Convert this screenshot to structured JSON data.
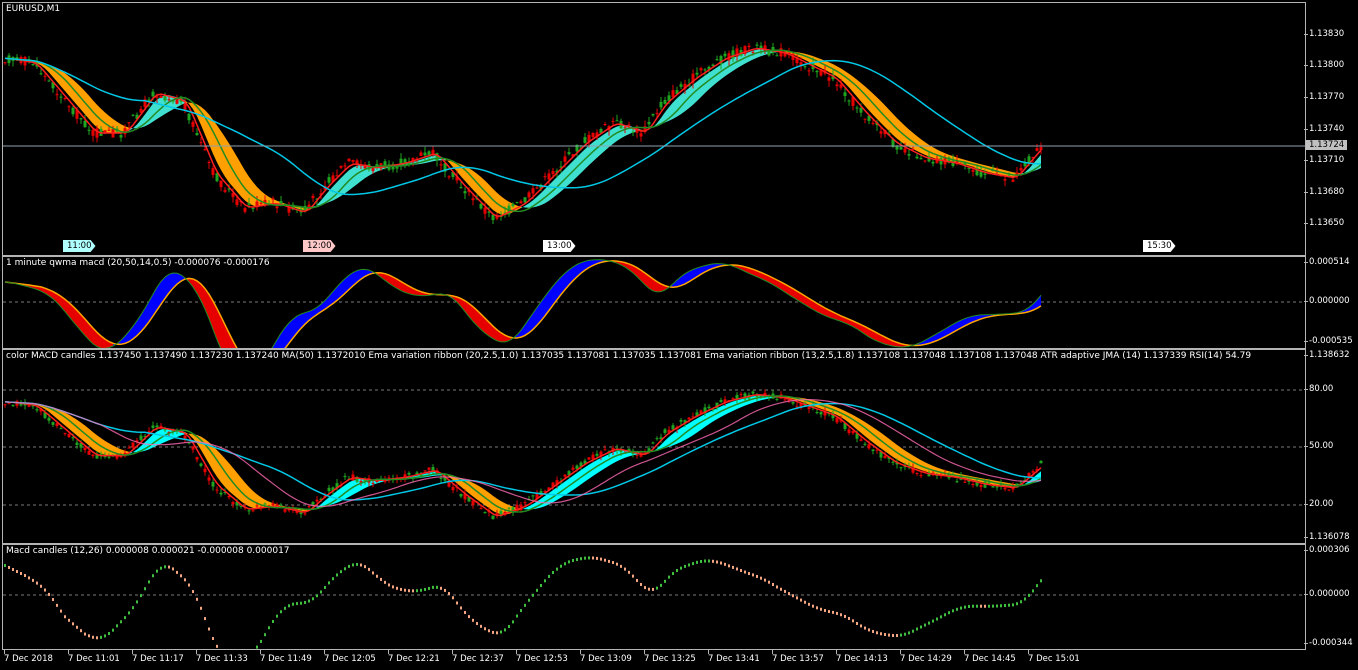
{
  "chart_window": {
    "symbol_title": "EURUSD,M1",
    "current_price": "1.13724",
    "price_axis_labels": [
      "1.13830",
      "1.13800",
      "1.13770",
      "1.13740",
      "1.13710",
      "1.13680",
      "1.13650"
    ],
    "session_labels": [
      {
        "text": "11:00",
        "color": "#b0ffff"
      },
      {
        "text": "12:00",
        "color": "#ffc8c8"
      },
      {
        "text": "13:00",
        "color": "#ffffff"
      },
      {
        "text": "15:30",
        "color": "#ffffff"
      }
    ]
  },
  "indicator_1": {
    "title": "1 minute qwma macd (20,50,14,0.5) -0.000076 -0.000176",
    "axis_labels": [
      "0.000514",
      "0.000000",
      "-0.000535"
    ]
  },
  "indicator_2": {
    "title": "color MACD candles 1.137450 1.137490 1.137230 1.137240 MA(50) 1.1372010 Ema variation ribbon (20,2.5,1.0) 1.137035 1.137081 1.137035 1.137081 Ema variation ribbon (13,2.5,1.8) 1.137108 1.137048 1.137108 1.137048 ATR adaptive JMA (14) 1.137339 RSI(14) 54.79",
    "axis_labels": [
      "1.138632",
      "80.00",
      "50.00",
      "20.00",
      "1.136078"
    ]
  },
  "indicator_3": {
    "title": "Macd candles (12,26) 0.000008 0.000021 -0.000008 0.000017",
    "axis_labels": [
      "0.000306",
      "0.000000",
      "-0.000344"
    ]
  },
  "time_axis": [
    "7 Dec 2018",
    "7 Dec 11:01",
    "7 Dec 11:17",
    "7 Dec 11:33",
    "7 Dec 11:49",
    "7 Dec 12:05",
    "7 Dec 12:21",
    "7 Dec 12:37",
    "7 Dec 12:53",
    "7 Dec 13:09",
    "7 Dec 13:25",
    "7 Dec 13:41",
    "7 Dec 13:57",
    "7 Dec 14:13",
    "7 Dec 14:29",
    "7 Dec 14:45",
    "7 Dec 15:01"
  ],
  "colors": {
    "bull": "#1fa51f",
    "bear": "#e60000",
    "ribbon_up": "#40e0d0",
    "ribbon_down": "#ff9f00",
    "ribbon_up_2": "#00ffff",
    "ma_line": "#00c8e6",
    "signal": "#0000ff",
    "green_line": "#228b22",
    "red_line": "#ff2020",
    "pink_line": "#ff69b4"
  }
}
